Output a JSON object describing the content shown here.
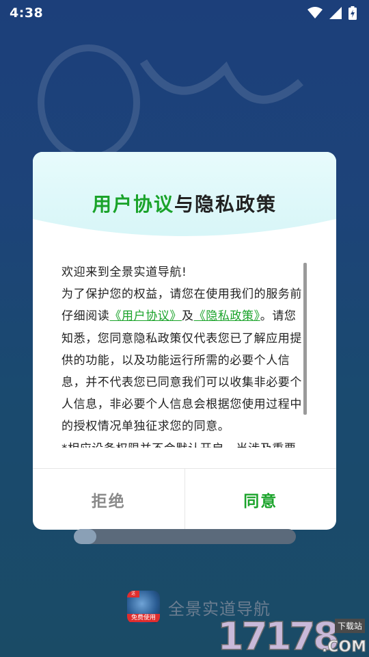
{
  "status_bar": {
    "time": "4:38"
  },
  "dialog": {
    "title_part1": "用户协议",
    "title_part2": "与隐私政策",
    "paragraphs": {
      "p1": "欢迎来到全景实道导航!",
      "p2_prefix": "为了保护您的权益，请您在使用我们的服务前仔细阅读",
      "link_user_agreement": "《用户协议》",
      "and": "及",
      "link_privacy_policy": "《隐私政策》",
      "p2_suffix": "。请您知悉，您同意隐私政策仅代表您已了解应用提供的功能，以及功能运行所需的必要个人信息，并不代表您已同意我们可以收集非必要个人信息，非必要个人信息会根据您使用过程中的授权情况单独征求您的同意。",
      "p3": "*相应设备权限并不会默认开启，当涉及重要"
    },
    "reject_label": "拒绝",
    "agree_label": "同意"
  },
  "loading": {
    "progress_fraction": 0.1
  },
  "app": {
    "name": "全景实道导航",
    "logo_badge": "免费使用",
    "logo_corner": "送"
  },
  "watermark": {
    "number": "17178",
    "tag": "下载站",
    "domain": ".COM"
  },
  "colors": {
    "accent_green": "#1aa32a",
    "background_blue": "#1d4379"
  }
}
